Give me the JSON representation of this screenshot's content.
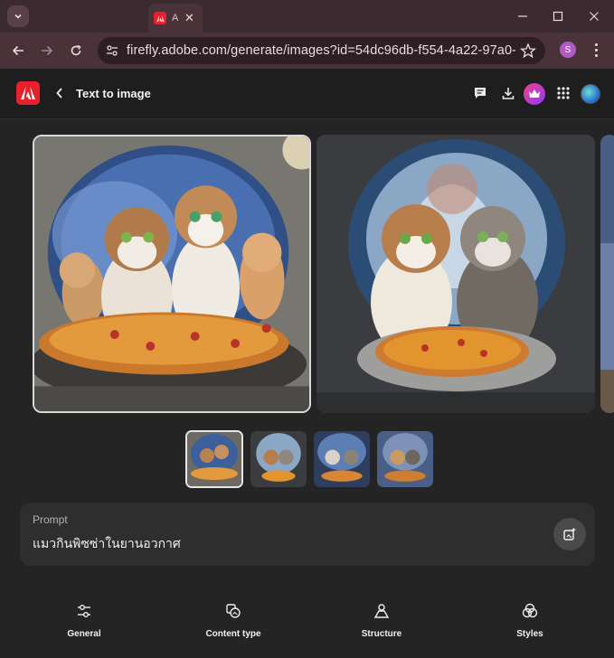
{
  "browser": {
    "tab_title": "A",
    "url": "firefly.adobe.com/generate/images?id=54dc96db-f554-4a22-97a0-70cd4522...",
    "profile_initial": "S"
  },
  "app": {
    "title": "Text to image"
  },
  "prompt": {
    "label": "Prompt",
    "text": "แมวกินพิซซ่าในยานอวกาศ"
  },
  "tools": [
    {
      "label": "General",
      "icon": "sliders-icon"
    },
    {
      "label": "Content type",
      "icon": "content-type-icon"
    },
    {
      "label": "Structure",
      "icon": "structure-icon"
    },
    {
      "label": "Styles",
      "icon": "styles-icon"
    }
  ],
  "colors": {
    "adobe_red": "#e8212f",
    "background": "#242424",
    "tabstrip": "#3b2a30"
  }
}
